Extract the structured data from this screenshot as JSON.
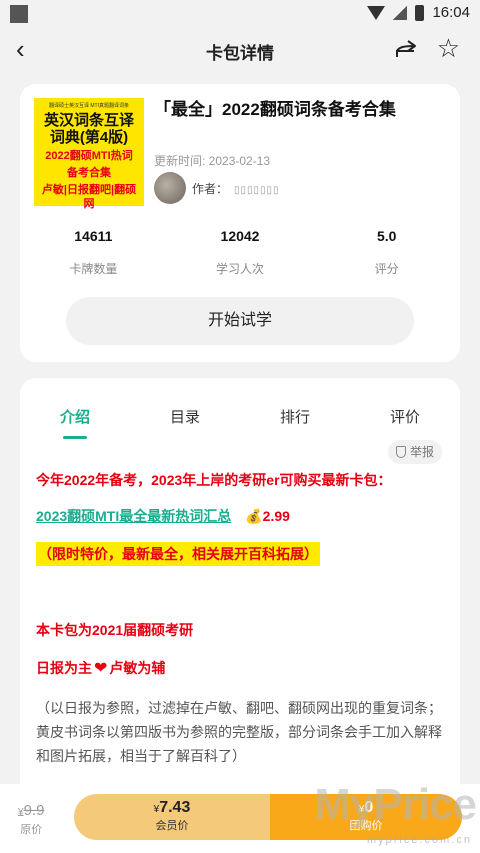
{
  "status": {
    "time": "16:04"
  },
  "header": {
    "title": "卡包详情",
    "back": "‹",
    "star": "☆"
  },
  "deck": {
    "cover": {
      "top_text": "翻译硕士英汉互译 MTI真题翻译词条",
      "title_line1": "英汉词条互译",
      "title_line2": "词典(第4版)",
      "red_line1": "2022翻硕MTI热词",
      "red_line2": "备考合集",
      "red_line3": "卢敏|日报翻吧|翻硕网"
    },
    "title": "「最全」2022翻硕词条备考合集",
    "update_time": "更新时间: 2023-02-13",
    "author_label": "作者：",
    "author_name": "▯▯▯▯▯▯▯"
  },
  "stats": [
    {
      "value": "14611",
      "label": "卡牌数量"
    },
    {
      "value": "12042",
      "label": "学习人次"
    },
    {
      "value": "5.0",
      "label": "评分"
    }
  ],
  "trial_button": "开始试学",
  "tabs": [
    "介绍",
    "目录",
    "排行",
    "评价"
  ],
  "report": "举报",
  "intro": {
    "p1": "今年2022年备考，2023年上岸的考研er可购买最新卡包：",
    "link": "2023翻硕MTI最全最新热词汇总",
    "coin": "💰2.99",
    "highlight": "（限时特价，最新最全，相关展开百科拓展）",
    "p4": "本卡包为2021届翻硕考研",
    "p5_a": "日报为主",
    "p5_heart": "❤",
    "p5_b": "卢敏为辅",
    "p6": "（以日报为参照，过滤掉在卢敏、翻吧、翻硕网出现的重复词条；黄皮书词条以第四版书为参照的完整版，部分词条会手工加入解释和图片拓展，相当于了解百科了）"
  },
  "bottom": {
    "orig_currency": "¥",
    "orig_price": "9.9",
    "orig_label": "原价",
    "vip_currency": "¥",
    "vip_price": "7.43",
    "vip_label": "会员价",
    "group_currency": "¥",
    "group_price": "0",
    "group_label": "团购价"
  },
  "watermark": {
    "brand": "MyPrice",
    "url": "myprice.com.cn"
  },
  "colors": {
    "accent": "#1aad8f",
    "red": "#e60012",
    "vip": "#f4c97a",
    "group": "#f9a81a",
    "cover": "#ffe600"
  }
}
